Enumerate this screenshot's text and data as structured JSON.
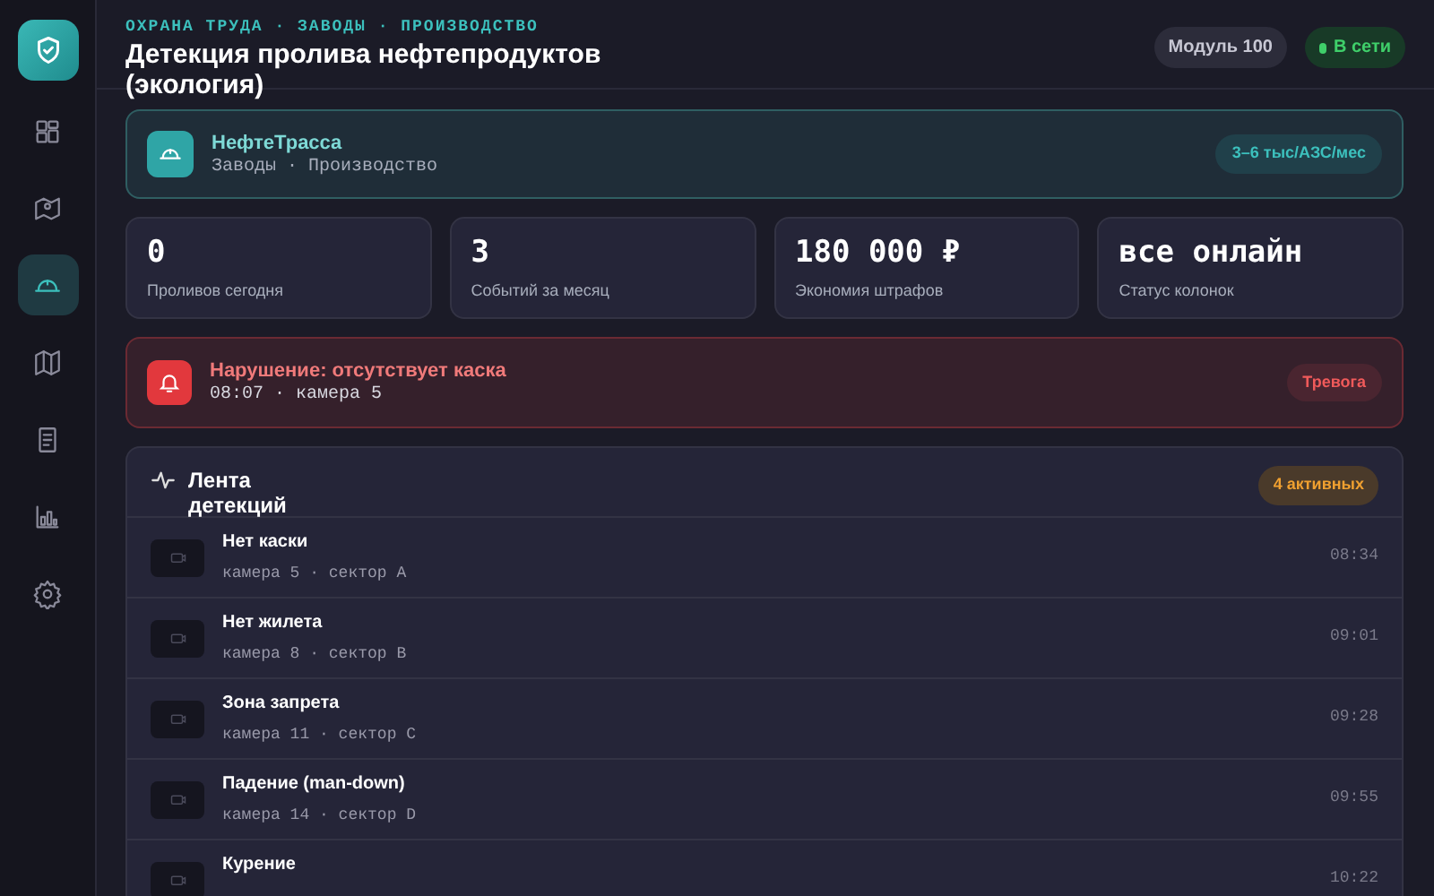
{
  "sidebar": {
    "items": [
      {
        "selected": false
      },
      {
        "selected": false
      },
      {
        "selected": true
      },
      {
        "selected": false
      },
      {
        "selected": false
      },
      {
        "selected": false
      },
      {
        "selected": false
      }
    ]
  },
  "header": {
    "breadcrumb": "ОХРАНА ТРУДА · ЗАВОДЫ · ПРОИЗВОДСТВО",
    "title": "Детекция пролива нефтепродуктов (экология)",
    "module": "Модуль 100",
    "status": "В сети"
  },
  "hero": {
    "name": "НефтеТрасса",
    "subtitle": "Заводы · Производство",
    "price": "3–6 тыс/АЗС/мес"
  },
  "stats": [
    {
      "value": "0",
      "label": "Проливов сегодня"
    },
    {
      "value": "3",
      "label": "Событий за месяц"
    },
    {
      "value": "180 000 ₽",
      "label": "Экономия штрафов"
    },
    {
      "value": "все онлайн",
      "label": "Статус колонок"
    }
  ],
  "alert": {
    "title": "Нарушение: отсутствует каска",
    "detail": "08:07 · камера 5",
    "badge": "Тревога"
  },
  "feed": {
    "title": "Лента детекций",
    "badge": "4 активных",
    "rows": [
      {
        "title": "Нет каски",
        "detail": "камера 5 · сектор A",
        "time": "08:34"
      },
      {
        "title": "Нет жилета",
        "detail": "камера 8 · сектор B",
        "time": "09:01"
      },
      {
        "title": "Зона запрета",
        "detail": "камера 11 · сектор C",
        "time": "09:28"
      },
      {
        "title": "Падение (man-down)",
        "detail": "камера 14 · сектор D",
        "time": "09:55"
      },
      {
        "title": "Курение",
        "time": "10:22"
      }
    ]
  }
}
